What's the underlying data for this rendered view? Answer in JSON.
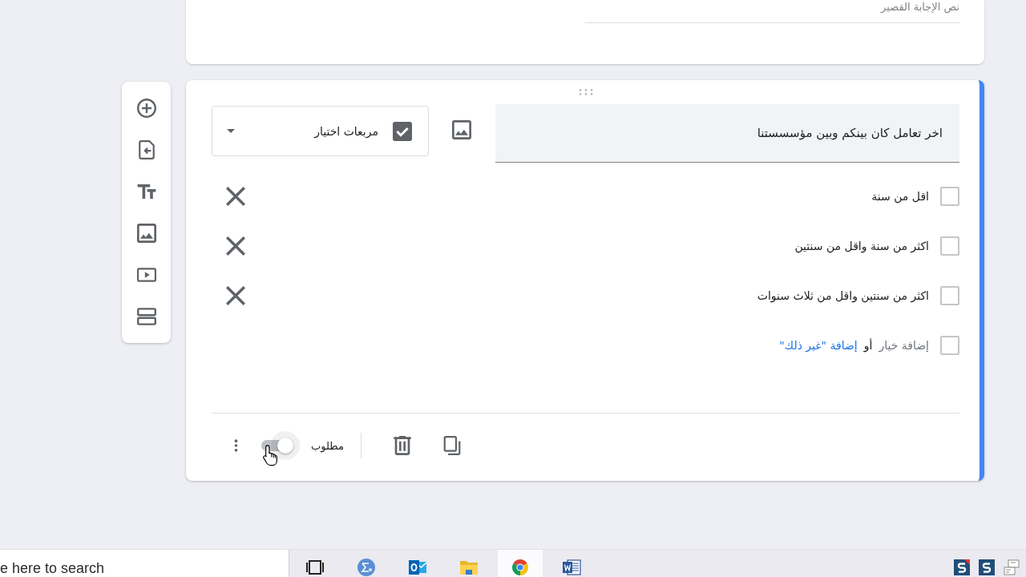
{
  "short_answer_question": {
    "answer_placeholder": "نص الإجابة القصير"
  },
  "question": {
    "active": true,
    "title": "اخر تعامل كان بينكم وبين مؤسسستنا",
    "type_label": "مربعات اختيار",
    "options": [
      {
        "label": "اقل من سنة",
        "checked": false
      },
      {
        "label": "اكثر من سنة واقل من سنتين",
        "checked": false
      },
      {
        "label": "اكثر من سنتين واقل من ثلاث سنوات",
        "checked": false
      }
    ],
    "add_option": "إضافة خيار",
    "or": "أو",
    "add_other": "إضافة \"غير ذلك\"",
    "required": {
      "label": "مطلوب",
      "on": false
    }
  },
  "taskbar": {
    "search_placeholder": "e here to search",
    "apps": [
      {
        "selected": false
      },
      {
        "selected": false
      },
      {
        "selected": false
      },
      {
        "selected": false
      },
      {
        "selected": true
      },
      {
        "selected": false
      }
    ]
  }
}
